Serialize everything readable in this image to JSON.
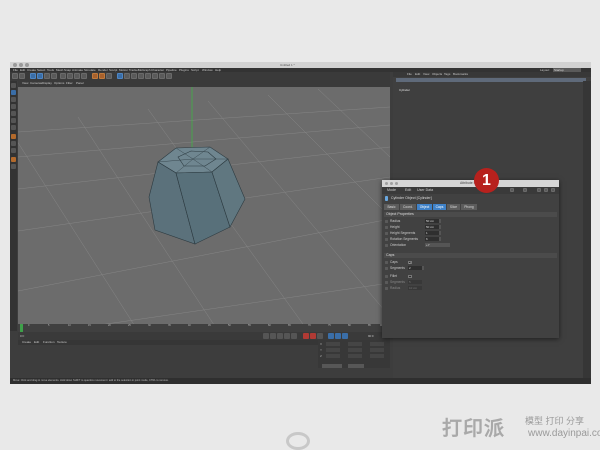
{
  "window": {
    "title": "Untitled 1 *"
  },
  "menu": [
    "File",
    "Edit",
    "Create",
    "Select",
    "Tools",
    "Mesh",
    "Snap",
    "Animate",
    "Simulate",
    "Render",
    "Sculpt",
    "Motion Tracker",
    "MoGraph",
    "Character",
    "Pipeline",
    "Plugins",
    "Script",
    "Window",
    "Help"
  ],
  "layout": {
    "label": "Layout:",
    "value": "Startup"
  },
  "viewport_menu": [
    "View",
    "Cameras",
    "Display",
    "Options",
    "Filter",
    "Panel"
  ],
  "object_manager": {
    "menu": [
      "File",
      "Edit",
      "View",
      "Objects",
      "Tags",
      "Bookmarks"
    ],
    "row_label": "Cylinder"
  },
  "timeline": {
    "frames": [
      "0",
      "5",
      "10",
      "15",
      "20",
      "25",
      "30",
      "35",
      "40",
      "45",
      "50",
      "55",
      "60",
      "65",
      "70",
      "75",
      "80",
      "85",
      "90"
    ],
    "current": "0 F",
    "end": "90 F"
  },
  "material_menu": [
    "Create",
    "Edit",
    "Function",
    "Texture"
  ],
  "coords": {
    "rows": [
      "X",
      "Y",
      "Z"
    ],
    "values": [
      "0 cm",
      "0 cm",
      "0 cm"
    ],
    "apply": "Apply"
  },
  "status": "Move: Click and drag to move elements. Hold down SHIFT to quantize movement / add to the selection in point mode, CTRL to remove.",
  "attr": {
    "title": "Attribute Manager",
    "menu": [
      "Mode",
      "Edit",
      "User Data"
    ],
    "object_title": "Cylinder Object [Cylinder]",
    "tabs": [
      "Basic",
      "Coord.",
      "Object",
      "Caps",
      "Slice",
      "Phong"
    ],
    "section_object": "Object Properties",
    "props": [
      {
        "label": "Radius",
        "value": "50 cm"
      },
      {
        "label": "Height",
        "value": "50 cm"
      },
      {
        "label": "Height Segments",
        "value": "1"
      },
      {
        "label": "Rotation Segments",
        "value": "6"
      },
      {
        "label": "Orientation",
        "value": "+Y"
      }
    ],
    "section_caps": "Caps",
    "caps": [
      {
        "label": "Caps",
        "value": "✓"
      },
      {
        "label": "Segments",
        "value": "2"
      },
      {
        "label": "Fillet",
        "value": ""
      },
      {
        "label": "Segments",
        "value": "5"
      },
      {
        "label": "Radius",
        "value": "10 cm"
      }
    ]
  },
  "callout": "1",
  "watermark": {
    "brand": "打印派",
    "tagline": "模型 打印 分享",
    "url": "www.dayinpai.com"
  },
  "colors": {
    "accent": "#3f82c9",
    "callout": "#b7211d",
    "viewport": "#6c6c6c",
    "object": "#5b6f7a"
  }
}
